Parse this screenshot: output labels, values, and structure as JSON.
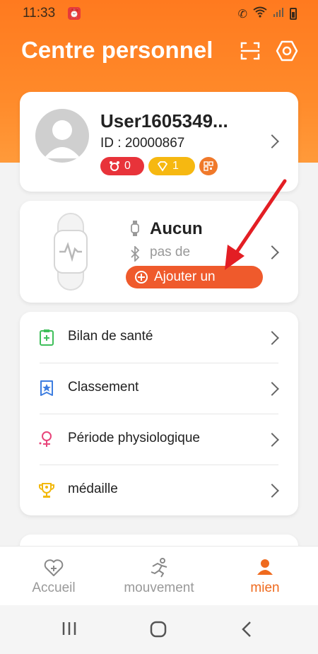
{
  "status_bar": {
    "time": "11:33"
  },
  "header": {
    "title": "Centre personnel"
  },
  "profile": {
    "username": "User1605349...",
    "id_text": "ID : 20000867",
    "badge_red_count": "0",
    "badge_yellow_count": "1"
  },
  "device": {
    "name": "Aucun",
    "status": "pas de",
    "add_label": "Ajouter un"
  },
  "menu": {
    "items": [
      {
        "label": "Bilan de santé",
        "icon": "health-report-icon"
      },
      {
        "label": "Classement",
        "icon": "ranking-icon"
      },
      {
        "label": "Période physiologique",
        "icon": "female-cycle-icon"
      },
      {
        "label": "médaille",
        "icon": "medal-icon"
      }
    ]
  },
  "bottom_nav": {
    "items": [
      {
        "label": "Accueil",
        "icon": "heart-plus-icon"
      },
      {
        "label": "mouvement",
        "icon": "running-icon"
      },
      {
        "label": "mien",
        "icon": "person-icon",
        "active": true
      }
    ]
  },
  "colors": {
    "brand": "#ff7a1f",
    "accent": "#ef5a2c",
    "active": "#ef6a1e"
  }
}
